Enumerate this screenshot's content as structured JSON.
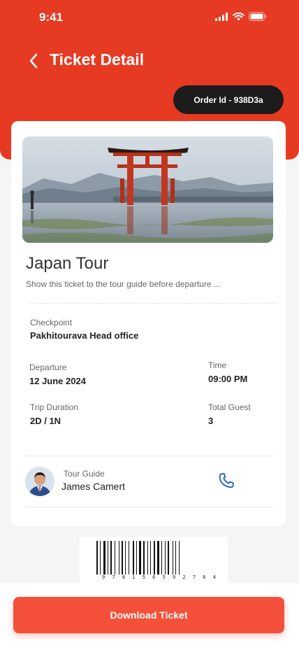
{
  "status_bar": {
    "time": "9:41"
  },
  "header": {
    "title": "Ticket Detail",
    "order_id": "Order Id - 938D3a"
  },
  "ticket": {
    "title": "Japan Tour",
    "subtitle": "Show this ticket to the tour guide before departure ...",
    "checkpoint_label": "Checkpoint",
    "checkpoint_value": "Pakhitourava Head office",
    "departure_label": "Departure",
    "departure_value": "12 June 2024",
    "time_label": "Time",
    "time_value": "09:00 PM",
    "duration_label": "Trip Duration",
    "duration_value": "2D / 1N",
    "guest_label": "Total Guest",
    "guest_value": "3"
  },
  "guide": {
    "label": "Tour Guide",
    "name": "James Camert"
  },
  "barcode": {
    "digits": "9 7 8 1 5 6 5 9 2 7 6 4"
  },
  "actions": {
    "download_label": "Download Ticket"
  },
  "colors": {
    "accent": "#e63a22",
    "button": "#f4503a",
    "pill": "#1c1c1c",
    "phone_icon": "#1e63c7"
  }
}
